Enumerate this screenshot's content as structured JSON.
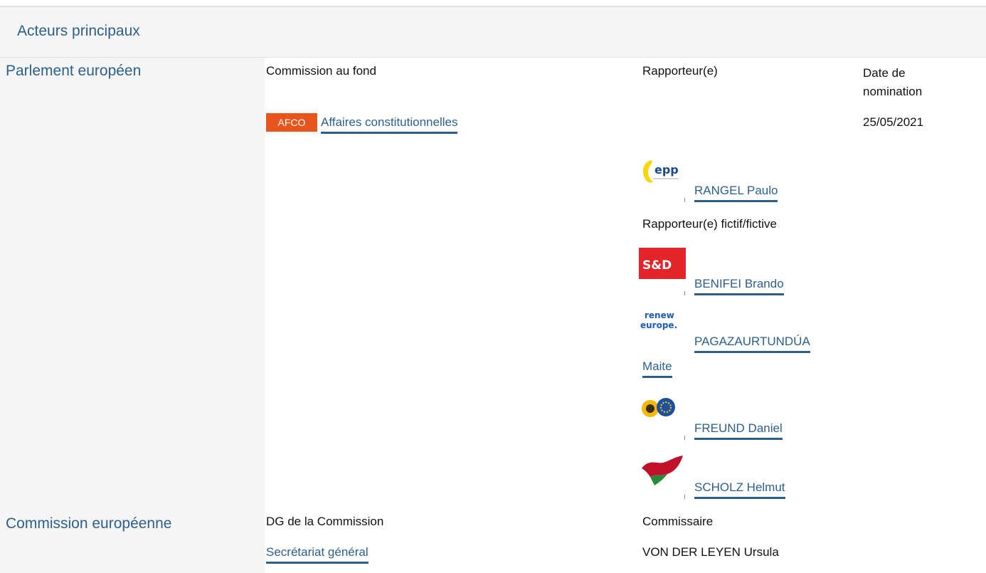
{
  "header": {
    "title": "Acteurs principaux"
  },
  "parlement": {
    "title": "Parlement européen",
    "col_committee": "Commission au fond",
    "col_rapporteur": "Rapporteur(e)",
    "col_date": "Date de nomination",
    "committee_badge": "AFCO",
    "committee_name": "Affaires constitutionnelles",
    "nomination_date": "25/05/2021",
    "rapporteur": {
      "name": "RANGEL Paulo",
      "group_logo": "epp-logo"
    },
    "shadow_label": "Rapporteur(e) fictif/fictive",
    "shadows": [
      {
        "name": "BENIFEI Brando",
        "group_logo": "sd-logo"
      },
      {
        "name": "PAGAZAURTUNDÚA Maite",
        "name_line1": "PAGAZAURTUNDÚA",
        "name_line2": "Maite",
        "group_logo": "renew-europe-logo"
      },
      {
        "name": "FREUND Daniel",
        "group_logo": "greens-efa-logo"
      },
      {
        "name": "SCHOLZ Helmut",
        "group_logo": "gue-ngl-logo"
      }
    ],
    "logo_text": {
      "epp": "epp",
      "sd": "S&D",
      "renew_1": "renew",
      "renew_2": "europe."
    }
  },
  "commission": {
    "title": "Commission européenne",
    "col_dg": "DG de la Commission",
    "col_commissioner": "Commissaire",
    "dg_name": "Secrétariat général",
    "commissioner_name": "VON DER LEYEN Ursula"
  },
  "colors": {
    "link": "#2c5f8a",
    "badge": "#e8551c",
    "panel": "#f5f5f5",
    "sd_red": "#e3242b",
    "renew_blue": "#1c5db5",
    "gue_red": "#c0102a",
    "gue_green": "#2a8a3a"
  }
}
